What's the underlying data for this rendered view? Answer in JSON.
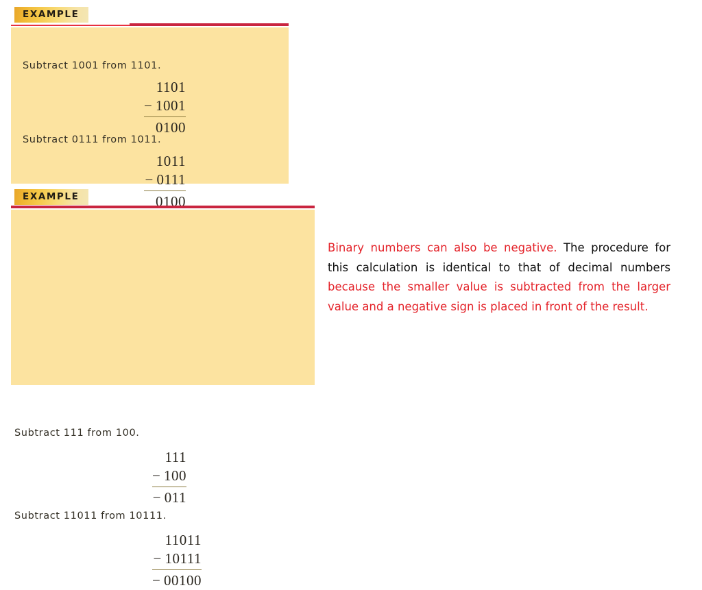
{
  "slide": {
    "background_color": "#ffffff",
    "panel_color": "#fce3a0",
    "accent_red": "#c9253f",
    "highlight_red": "#e4232a"
  },
  "examples": [
    {
      "badge_label": "EXAMPLE",
      "problems": [
        {
          "prompt": "Subtract 1001 from 1101.",
          "minuend": "1101",
          "operator": "−",
          "subtrahend": "1001",
          "result": "0100",
          "result_sign": ""
        },
        {
          "prompt": "Subtract 0111 from 1011.",
          "minuend": "1011",
          "operator": "−",
          "subtrahend": "0111",
          "result": "0100",
          "result_sign": ""
        }
      ]
    },
    {
      "badge_label": "EXAMPLE",
      "problems": [
        {
          "prompt": "Subtract 111 from 100.",
          "minuend": "111",
          "operator": "−",
          "subtrahend": "100",
          "result": "011",
          "result_sign": "−"
        },
        {
          "prompt": "Subtract 11011 from 10111.",
          "minuend": "11011",
          "operator": "−",
          "subtrahend": "10111",
          "result": "00100",
          "result_sign": "−"
        }
      ]
    }
  ],
  "explanation": {
    "segment_1": "Binary numbers can also be negative.",
    "segment_2": " The procedure for this calculation is identical to that of decimal numbers ",
    "segment_3": "because the smaller value is subtracted from the larger value and a negative sign is placed in front of the result."
  }
}
